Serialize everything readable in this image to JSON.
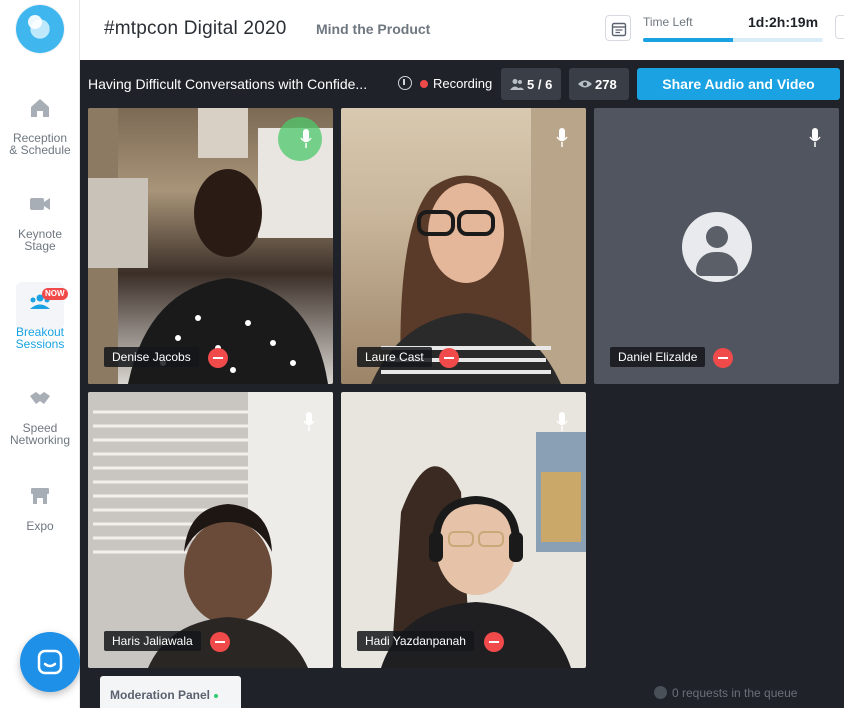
{
  "sidebar": {
    "items": [
      {
        "label_line1": "Reception",
        "label_line2": "& Schedule",
        "icon": "home-icon"
      },
      {
        "label_line1": "Keynote",
        "label_line2": "Stage",
        "icon": "video-camera-icon"
      },
      {
        "label_line1": "Breakout",
        "label_line2": "Sessions",
        "icon": "group-icon",
        "badge": "NOW"
      },
      {
        "label_line1": "Speed",
        "label_line2": "Networking",
        "icon": "handshake-icon"
      },
      {
        "label_line1": "Expo",
        "label_line2": "",
        "icon": "booth-icon"
      }
    ]
  },
  "header": {
    "event_title": "#mtpcon Digital 2020",
    "org_name": "Mind the Product",
    "time_left_label": "Time Left",
    "time_left_value": "1d:2h:19m",
    "time_progress": 0.5
  },
  "session": {
    "title": "Having Difficult Conversations with Confide...",
    "recording_label": "Recording",
    "participants": "5 / 6",
    "viewers": "278",
    "share_button": "Share Audio and Video"
  },
  "tiles": [
    {
      "name": "Denise Jacobs",
      "speaking": true,
      "video": true
    },
    {
      "name": "Laure Cast",
      "speaking": false,
      "video": true
    },
    {
      "name": "Daniel Elizalde",
      "speaking": false,
      "video": false
    },
    {
      "name": "Haris Jaliawala",
      "speaking": false,
      "video": true
    },
    {
      "name": "Hadi Yazdanpanah",
      "speaking": false,
      "video": true
    }
  ],
  "footer": {
    "moderation_panel": "Moderation Panel",
    "queue_text": "0 requests in the queue"
  },
  "colors": {
    "accent": "#1aa2e3",
    "recording": "#f04a4a",
    "stage_bg": "#1f2228",
    "speaking": "#4cc86a"
  }
}
